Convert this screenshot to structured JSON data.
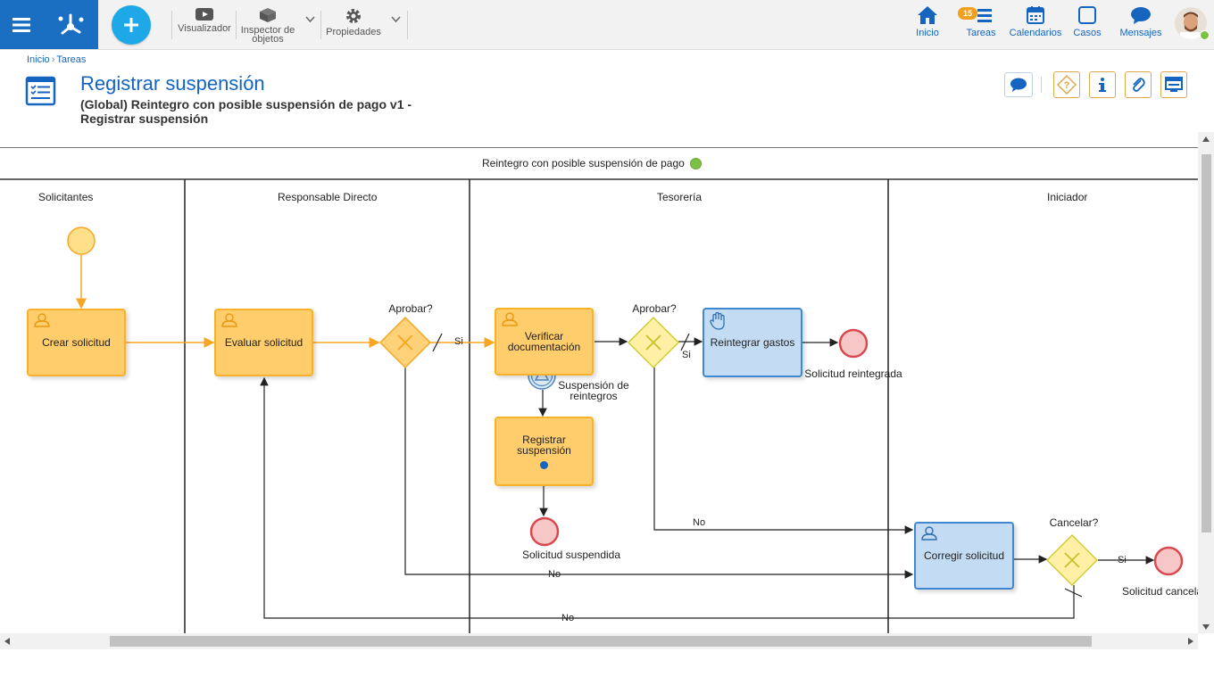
{
  "toolbar": {
    "visualizer": "Visualizador",
    "inspector_line1": "Inspector de",
    "inspector_line2": "objetos",
    "properties": "Propiedades"
  },
  "nav": {
    "home": "Inicio",
    "tasks": "Tareas",
    "tasks_badge": "15",
    "calendars": "Calendarios",
    "cases": "Casos",
    "messages": "Mensajes"
  },
  "breadcrumb": {
    "home": "Inicio",
    "sep": "›",
    "tasks": "Tareas"
  },
  "page": {
    "title": "Registrar suspensión",
    "subtitle": "(Global) Reintegro con posible suspensión de pago v1 - Registrar suspensión"
  },
  "diagram": {
    "pool_title": "Reintegro con posible suspensión de pago",
    "lanes": [
      "Solicitantes",
      "Responsable Directo",
      "Tesorería",
      "Iniciador"
    ],
    "tasks": {
      "crear": "Crear solicitud",
      "evaluar": "Evaluar solicitud",
      "verificar": "Verificar documentación",
      "registrar": "Registrar suspensión",
      "reintegrar": "Reintegrar gastos",
      "corregir": "Corregir solicitud"
    },
    "gateways": {
      "aprobar1": "Aprobar?",
      "aprobar2": "Aprobar?",
      "cancelar": "Cancelar?"
    },
    "events": {
      "suspension_line1": "Suspensión de",
      "suspension_line2": "reintegros",
      "reintegrada": "Solicitud reintegrada",
      "suspendida": "Solicitud suspendida",
      "cancelada": "Solicitud cancela"
    },
    "flows": {
      "si1": "Si",
      "si2": "Si",
      "si3": "Si",
      "no1": "No",
      "no2": "No",
      "no3": "No"
    }
  },
  "colors": {
    "brand_blue": "#1b6fc2",
    "add_blue": "#1fa8e8",
    "task_orange": "#ffcd6b",
    "task_blue": "#c3dcf3",
    "gateway_yellow": "#fff0a6",
    "end_red": "#f7c6c6",
    "start_yellow": "#ffe08a",
    "status_green": "#7cc142"
  }
}
